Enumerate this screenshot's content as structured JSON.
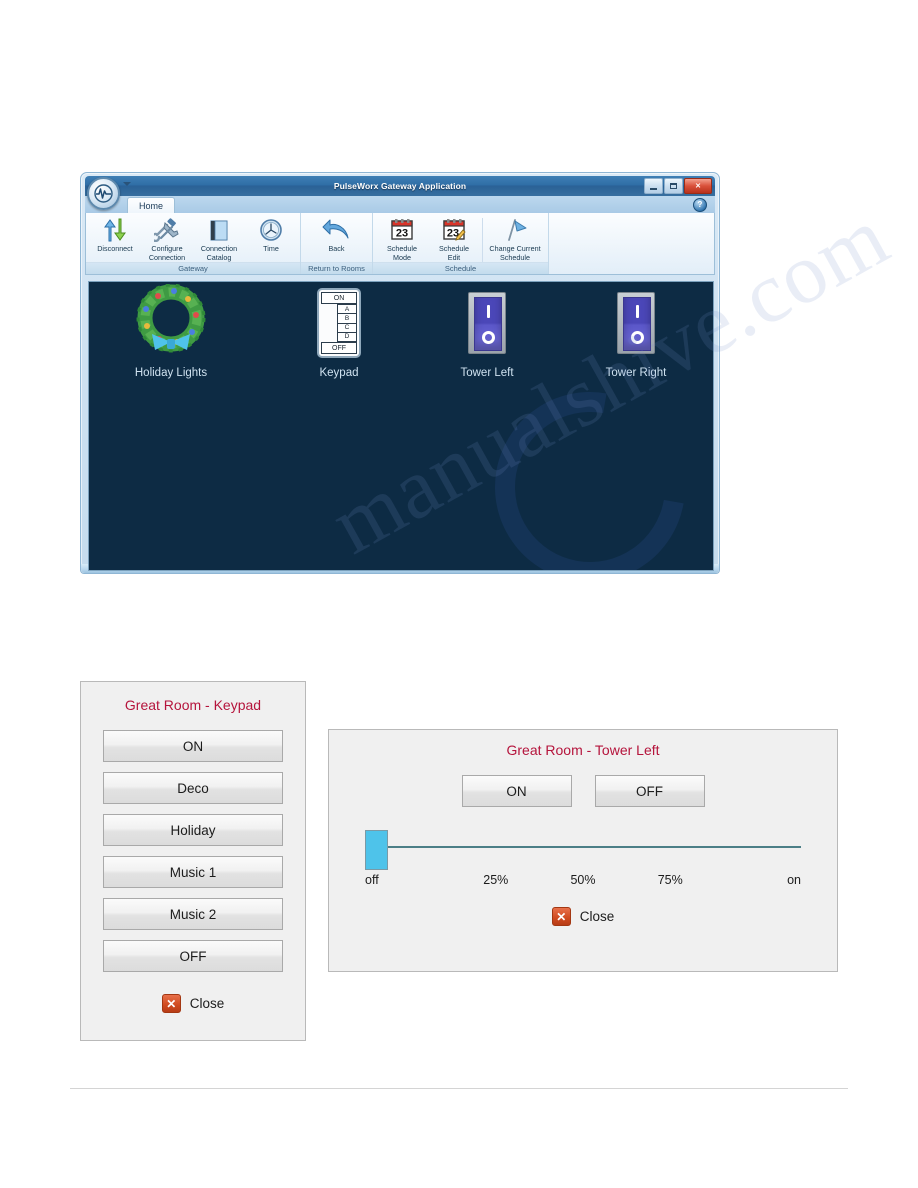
{
  "app_window": {
    "title": "PulseWorx Gateway Application",
    "logo_icon": "pulseworx-logo-icon",
    "quick_access_icon": "quick-access-dropdown-icon",
    "window_buttons": {
      "minimize": "minimize-icon",
      "maximize": "maximize-icon",
      "close": "✕"
    },
    "help_icon": "?",
    "tabs": [
      {
        "label": "Home",
        "active": true
      }
    ],
    "ribbon": {
      "groups": [
        {
          "title": "Gateway",
          "buttons": [
            {
              "label": "Disconnect",
              "icon": "disconnect-arrows-icon"
            },
            {
              "label": "Configure\nConnection",
              "icon": "configure-tools-icon"
            },
            {
              "label": "Connection\nCatalog",
              "icon": "book-icon"
            },
            {
              "label": "Time",
              "icon": "clock-icon"
            }
          ]
        },
        {
          "title": "Return to Rooms",
          "buttons": [
            {
              "label": "Back",
              "icon": "back-arrow-icon"
            }
          ]
        },
        {
          "title": "Schedule",
          "buttons": [
            {
              "label": "Schedule\nMode",
              "icon": "calendar-icon",
              "day": "23"
            },
            {
              "label": "Schedule\nEdit",
              "icon": "calendar-edit-icon",
              "day": "23"
            },
            {
              "label": "Change Current\nSchedule",
              "icon": "flag-icon"
            }
          ]
        }
      ]
    },
    "canvas": {
      "background_color": "#0d2b44",
      "devices": [
        {
          "label": "Holiday Lights",
          "icon": "wreath-icon",
          "type": "wreath"
        },
        {
          "label": "Keypad",
          "icon": "keypad-icon",
          "type": "keypad",
          "keys": {
            "top": "ON",
            "middle": [
              "A",
              "B",
              "C",
              "D"
            ],
            "bottom": "OFF"
          }
        },
        {
          "label": "Tower Left",
          "icon": "rocker-switch-icon",
          "type": "rocker"
        },
        {
          "label": "Tower Right",
          "icon": "rocker-switch-icon",
          "type": "rocker"
        }
      ]
    }
  },
  "keypad_dialog": {
    "title": "Great Room - Keypad",
    "title_color": "#b5143c",
    "buttons": [
      {
        "label": "ON"
      },
      {
        "label": "Deco"
      },
      {
        "label": "Holiday"
      },
      {
        "label": "Music 1"
      },
      {
        "label": "Music 2"
      },
      {
        "label": "OFF"
      }
    ],
    "close": {
      "label": "Close",
      "icon": "close-x-icon",
      "glyph": "✕"
    }
  },
  "tower_dialog": {
    "title": "Great Room - Tower Left",
    "title_color": "#b5143c",
    "buttons": [
      {
        "label": "ON"
      },
      {
        "label": "OFF"
      }
    ],
    "slider": {
      "value": 0,
      "min": 0,
      "max": 100,
      "handle_color": "#4ec3ea",
      "ticks": [
        "off",
        "25%",
        "50%",
        "75%",
        "on"
      ]
    },
    "close": {
      "label": "Close",
      "icon": "close-x-icon",
      "glyph": "✕"
    }
  },
  "page": {
    "watermark": "manualshive.com"
  }
}
